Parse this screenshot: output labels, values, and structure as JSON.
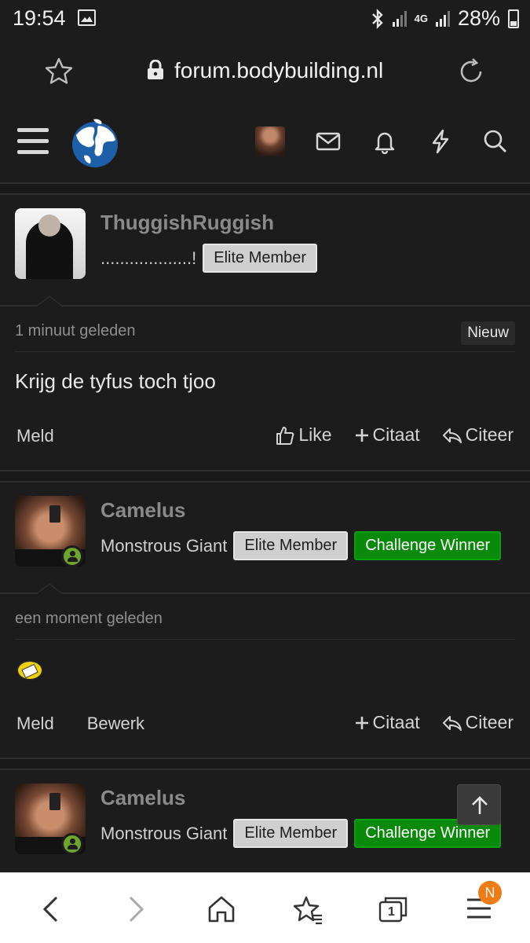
{
  "status_bar": {
    "time": "19:54",
    "network": "4G",
    "battery": "28%"
  },
  "browser": {
    "url": "forum.bodybuilding.nl",
    "tab_count": "1",
    "menu_badge": "N"
  },
  "posts": [
    {
      "username": "ThuggishRuggish",
      "title": "...................!",
      "badges": [
        "Elite Member"
      ],
      "time": "1 minuut geleden",
      "new_label": "Nieuw",
      "body": "Krijg de tyfus toch tjoo",
      "actions_left": [
        "Meld"
      ],
      "actions_right": [
        "Like",
        "Citaat",
        "Citeer"
      ]
    },
    {
      "username": "Camelus",
      "title": "Monstrous Giant",
      "badges": [
        "Elite Member",
        "Challenge Winner"
      ],
      "time": "een moment geleden",
      "body_emoji": "smiley-emoji",
      "actions_left": [
        "Meld",
        "Bewerk"
      ],
      "actions_right": [
        "Citaat",
        "Citeer"
      ]
    },
    {
      "username": "Camelus",
      "title": "Monstrous Giant",
      "badges": [
        "Elite Member",
        "Challenge Winner"
      ]
    }
  ],
  "colors": {
    "background": "#1c1c1c",
    "elite_badge": "#cfcfcf",
    "challenge_badge": "#0a8a0a",
    "online": "#6fa52d",
    "menu_badge": "#f07a14"
  }
}
